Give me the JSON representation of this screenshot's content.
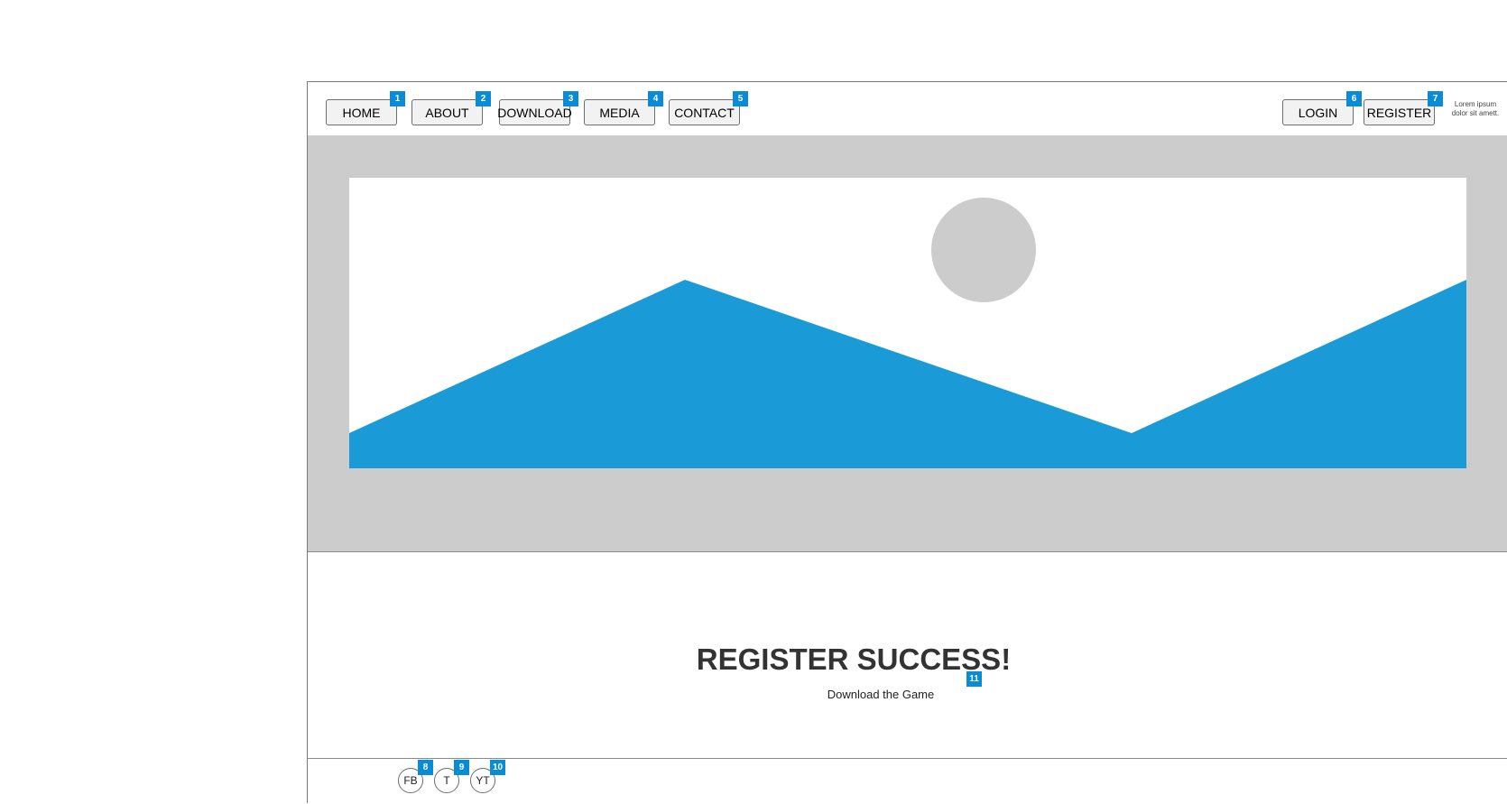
{
  "nav": {
    "items": [
      {
        "label": "HOME",
        "badge": "1"
      },
      {
        "label": "ABOUT",
        "badge": "2"
      },
      {
        "label": "DOWNLOAD",
        "badge": "3"
      },
      {
        "label": "MEDIA",
        "badge": "4"
      },
      {
        "label": "CONTACT",
        "badge": "5"
      }
    ],
    "right_items": [
      {
        "label": "LOGIN",
        "badge": "6"
      },
      {
        "label": "REGISTER",
        "badge": "7"
      }
    ],
    "lorem_line1": "Lorem ipsum",
    "lorem_line2": "dolor sit amett."
  },
  "hero": {
    "image_icon": "image-placeholder-icon",
    "colors": {
      "background": "#cccccc",
      "mountain": "#1a9ad6",
      "sun": "#cccccc"
    }
  },
  "content": {
    "title": "REGISTER SUCCESS!",
    "subtitle": "Download the Game",
    "badge": "11"
  },
  "footer": {
    "social": [
      {
        "label": "FB",
        "badge": "8"
      },
      {
        "label": "T",
        "badge": "9"
      },
      {
        "label": "YT",
        "badge": "10"
      }
    ]
  },
  "colors": {
    "badge": "#0a8bd6"
  }
}
